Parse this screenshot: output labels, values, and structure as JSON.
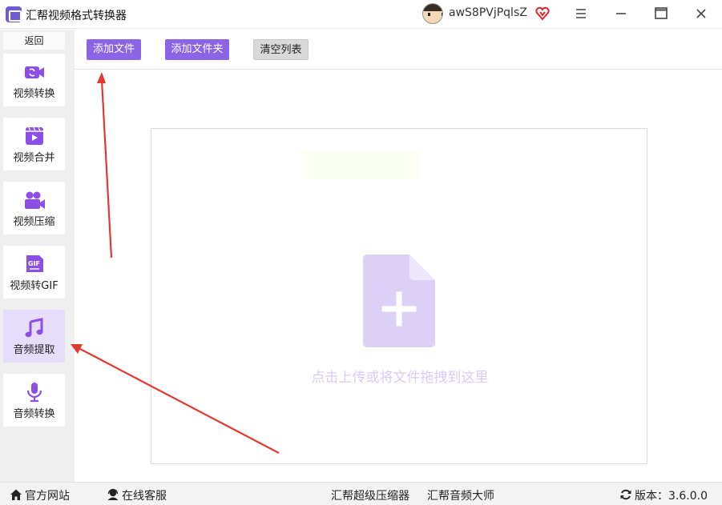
{
  "titlebar": {
    "app_title": "汇帮视频格式转换器",
    "username": "awS8PVjPqlsZ",
    "icons": [
      "app-logo-icon",
      "avatar",
      "vip-heart-icon",
      "menu-icon",
      "minimize-icon",
      "maximize-icon",
      "close-icon"
    ]
  },
  "sidebar": {
    "back_label": "返回",
    "items": [
      {
        "label": "视频转换",
        "icon": "video-convert-icon"
      },
      {
        "label": "视频合并",
        "icon": "video-merge-icon"
      },
      {
        "label": "视频压缩",
        "icon": "video-compress-icon"
      },
      {
        "label": "视频转GIF",
        "icon": "gif-icon"
      },
      {
        "label": "音频提取",
        "icon": "music-note-icon",
        "active": true
      },
      {
        "label": "音频转换",
        "icon": "microphone-icon"
      }
    ]
  },
  "toolbar": {
    "add_file": "添加文件",
    "add_folder": "添加文件夹",
    "clear_list": "清空列表"
  },
  "dropzone": {
    "hint": "点击上传或将文件拖拽到这里",
    "icon": "add-file-icon"
  },
  "statusbar": {
    "website": "官方网站",
    "support": "在线客服",
    "link_compressor": "汇帮超级压缩器",
    "link_audio": "汇帮音频大师",
    "version_label": "版本：3.6.0.0"
  },
  "colors": {
    "accent": "#8b63e5",
    "sidebar_bg": "#efefef",
    "active_item_bg": "#e5ddfb",
    "file_icon": "#d9c9f5",
    "arrow": "#e03a2f"
  }
}
